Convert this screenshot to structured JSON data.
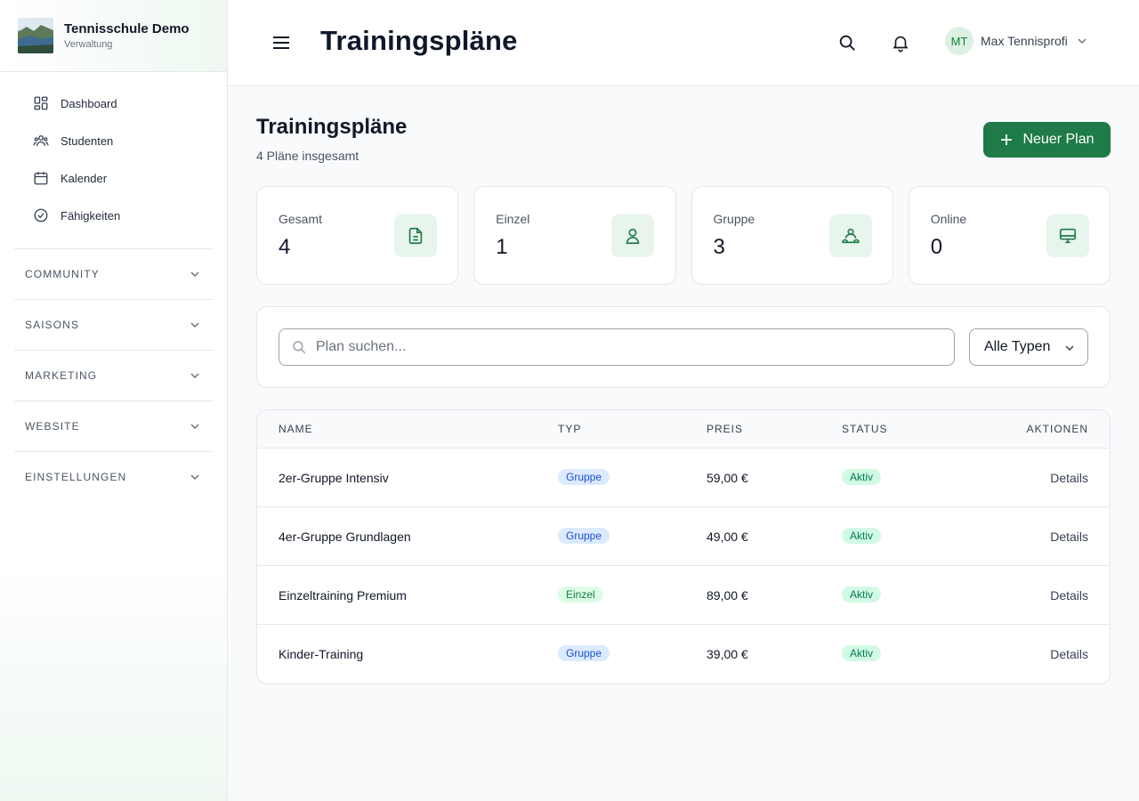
{
  "brand": {
    "name": "Tennisschule Demo",
    "sub": "Verwaltung"
  },
  "sidebar": {
    "items": [
      {
        "label": "Dashboard",
        "icon": "dashboard-icon"
      },
      {
        "label": "Studenten",
        "icon": "users-icon"
      },
      {
        "label": "Kalender",
        "icon": "calendar-icon"
      },
      {
        "label": "Fähigkeiten",
        "icon": "check-circle-icon"
      }
    ],
    "groups": [
      "COMMUNITY",
      "SAISONS",
      "MARKETING",
      "WEBSITE",
      "EINSTELLUNGEN"
    ]
  },
  "header": {
    "title": "Trainingspläne",
    "user": {
      "initials": "MT",
      "name": "Max Tennisprofi"
    }
  },
  "page": {
    "title": "Trainingspläne",
    "subtitle": "4 Pläne insgesamt",
    "new_button": "Neuer Plan"
  },
  "stats": [
    {
      "label": "Gesamt",
      "value": "4",
      "icon": "document-icon"
    },
    {
      "label": "Einzel",
      "value": "1",
      "icon": "user-icon"
    },
    {
      "label": "Gruppe",
      "value": "3",
      "icon": "group-icon"
    },
    {
      "label": "Online",
      "value": "0",
      "icon": "monitor-icon"
    }
  ],
  "filter": {
    "search_placeholder": "Plan suchen...",
    "type_select": "Alle Typen"
  },
  "table": {
    "headers": [
      "NAME",
      "TYP",
      "PREIS",
      "STATUS",
      "AKTIONEN"
    ],
    "rows": [
      {
        "name": "2er-Gruppe Intensiv",
        "type": "Gruppe",
        "price": "59,00 €",
        "status": "Aktiv",
        "action": "Details"
      },
      {
        "name": "4er-Gruppe Grundlagen",
        "type": "Gruppe",
        "price": "49,00 €",
        "status": "Aktiv",
        "action": "Details"
      },
      {
        "name": "Einzeltraining Premium",
        "type": "Einzel",
        "price": "89,00 €",
        "status": "Aktiv",
        "action": "Details"
      },
      {
        "name": "Kinder-Training",
        "type": "Gruppe",
        "price": "39,00 €",
        "status": "Aktiv",
        "action": "Details"
      }
    ]
  },
  "colors": {
    "accent": "#1e7a47",
    "accent_light": "#e8f5ec",
    "gruppe_badge": "#dbeafe",
    "einzel_badge": "#dcfce7",
    "status_badge": "#d1fae5"
  }
}
